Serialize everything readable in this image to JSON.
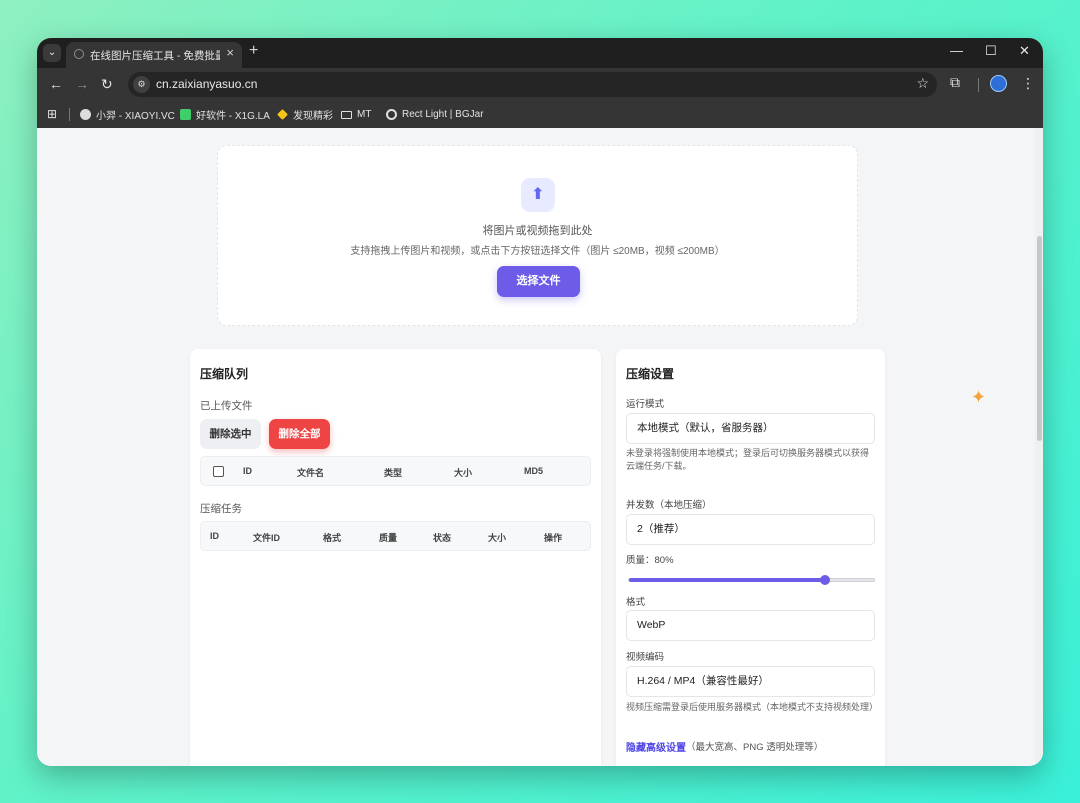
{
  "browser": {
    "tab_title": "在线图片压缩工具 - 免费批量压",
    "tab_close": "×",
    "new_tab": "+",
    "tab_menu_icon": "⌄",
    "url": "cn.zaixianyasuo.cn",
    "window_controls": {
      "minimize": "—",
      "maximize": "☐",
      "close": "✕"
    }
  },
  "bookmarks": [
    {
      "label": "小羿 - XIAOYI.VC",
      "icon_color": "#dcdcdc"
    },
    {
      "label": "好软件 - X1G.LA",
      "icon_color": "#3ecf6a"
    },
    {
      "label": "发现精彩",
      "icon_color": "#f5c518"
    },
    {
      "label": "MT",
      "icon_color": "#e0e0e0"
    },
    {
      "label": "Rect Light | BGJar",
      "icon_color": "#e0e0e0"
    }
  ],
  "upload": {
    "title": "将图片或视频拖到此处",
    "hint": "支持拖拽上传图片和视频，或点击下方按钮选择文件（图片 ≤20MB，视频 ≤200MB）",
    "button": "选择文件",
    "icon": "⬆"
  },
  "queue": {
    "title": "压缩队列",
    "uploaded_label": "已上传文件",
    "delete_selected": "删除选中",
    "delete_all": "删除全部",
    "files_columns": [
      "ID",
      "文件名",
      "类型",
      "大小",
      "MD5"
    ],
    "tasks_label": "压缩任务",
    "tasks_columns": [
      "ID",
      "文件ID",
      "格式",
      "质量",
      "状态",
      "大小",
      "操作"
    ]
  },
  "settings": {
    "title": "压缩设置",
    "mode_label": "运行模式",
    "mode_value": "本地模式（默认，省服务器）",
    "mode_note": "未登录将强制使用本地模式；登录后可切换服务器模式以获得云端任务/下载。",
    "concurrency_label": "并发数（本地压缩）",
    "concurrency_value": "2（推荐）",
    "quality_label": "质量：80%",
    "quality_percent": 80,
    "format_label": "格式",
    "format_value": "WebP",
    "codec_label": "视频编码",
    "codec_value": "H.264 / MP4（兼容性最好）",
    "codec_note": "视频压缩需登录后使用服务器模式（本地模式不支持视频处理）",
    "advanced_link": "隐藏高级设置",
    "advanced_hint": "（最大宽高、PNG 透明处理等）"
  },
  "colors": {
    "accent": "#6c5ce7",
    "danger": "#ef4444"
  }
}
